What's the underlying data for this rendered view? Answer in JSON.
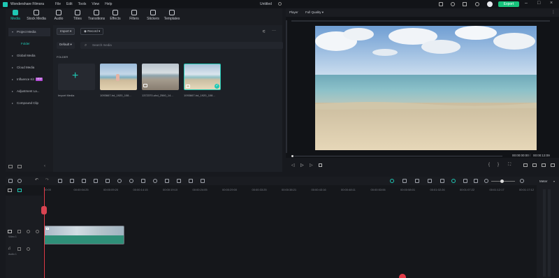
{
  "app": {
    "name": "Wondershare Filmora",
    "menu": [
      "File",
      "Edit",
      "Tools",
      "View",
      "Help"
    ],
    "document_title": "Untitled",
    "export_label": "Export"
  },
  "media_tabs": [
    "Media",
    "Stock Media",
    "Audio",
    "Titles",
    "Transitions",
    "Effects",
    "Filters",
    "Stickers",
    "Templates"
  ],
  "sidebar": {
    "items": [
      "Project Media",
      "Global Media",
      "Cloud Media",
      "Influence Kit",
      "Adjustment La...",
      "Compound Clip"
    ],
    "sub_item": "Folder",
    "badge": "NEW"
  },
  "media_toolbar": {
    "import_label": "Import",
    "record_label": "Record",
    "sort_label": "Default",
    "search_placeholder": "Search media"
  },
  "folder_label": "FOLDER",
  "import_card_label": "Import Media",
  "media_items": [
    {
      "caption": "1093667-hd_1920_108..."
    },
    {
      "caption": "1372370-uhd_2560_14..."
    },
    {
      "caption": "1093667-hd_1920_108..."
    }
  ],
  "player": {
    "label": "Player",
    "quality": "Full Quality",
    "current_time": "00:00:00:00",
    "total_time": "00:00:13:09"
  },
  "ruler_ticks": [
    "00:00",
    "00:00:04:25",
    "00:00:09:20",
    "00:00:14:15",
    "00:00:19:10",
    "00:00:24:05",
    "00:00:29:00",
    "00:00:33:25",
    "00:00:38:21",
    "00:00:43:16",
    "00:00:48:11",
    "00:00:53:06",
    "00:00:58:01",
    "00:01:02:26",
    "00:01:07:22",
    "00:01:12:17",
    "00:01:17:12"
  ],
  "tracks": {
    "video_label": "Video 1",
    "audio_label": "Audio 1"
  },
  "meter_label": "Meter",
  "colors": {
    "accent": "#1fc8b4",
    "export": "#17c37b",
    "playhead": "#e23b48"
  }
}
